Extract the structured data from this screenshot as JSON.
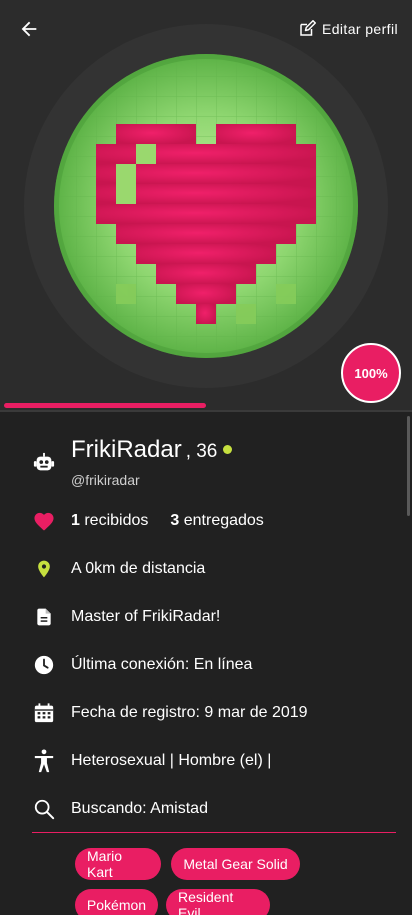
{
  "header": {
    "edit_label": "Editar perfil"
  },
  "match": {
    "percent_label": "100%",
    "progress_fraction": 0.49
  },
  "profile": {
    "username": "FrikiRadar",
    "age": ", 36",
    "handle": "@frikiradar",
    "online": true
  },
  "stats": {
    "received_count": "1",
    "received_label": " recibidos",
    "given_count": "3",
    "given_label": " entregados"
  },
  "details": {
    "distance": "A 0km de distancia",
    "bio": "Master of FrikiRadar!",
    "last_seen": "Última conexión: En línea",
    "registered": "Fecha de registro: 9 mar de 2019",
    "orientation": " Heterosexual |  Hombre (el) |",
    "looking_for": "Buscando: Amistad"
  },
  "tags": [
    "Mario Kart",
    "Metal Gear Solid",
    "Pokémon",
    "Resident Evil"
  ],
  "colors": {
    "accent": "#e91e63",
    "online": "#c6e03f",
    "location": "#c6e03f",
    "background": "#212121"
  },
  "icons": {
    "back": "arrow-left-icon",
    "edit": "edit-square-icon",
    "user": "robot-icon",
    "likes": "heart-icon",
    "location": "location-pin-icon",
    "bio": "document-icon",
    "last_seen": "clock-icon",
    "registered": "calendar-icon",
    "orientation": "person-icon",
    "looking_for": "search-icon"
  }
}
